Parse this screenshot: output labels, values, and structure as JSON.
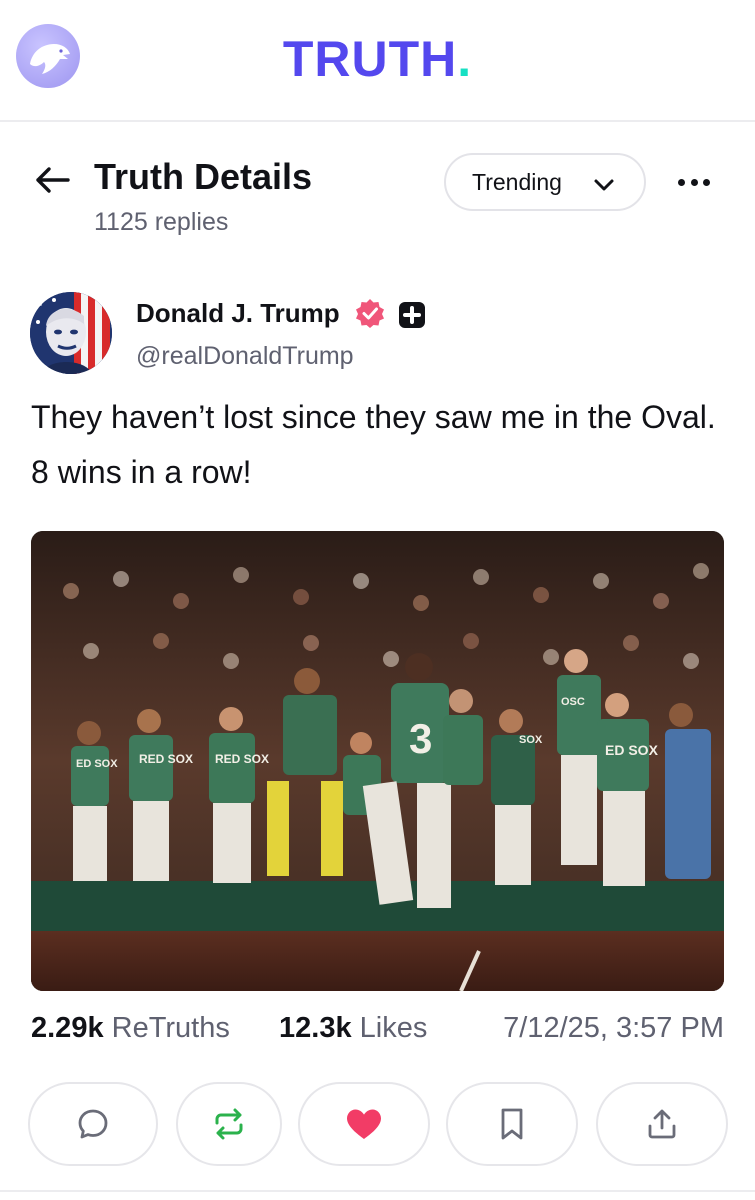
{
  "app": {
    "logo_icon": "eagle-logo-icon",
    "wordmark": "TRUTH",
    "wordmark_dot": ".",
    "brand_color": "#5448ee",
    "accent_color": "#17e0c3"
  },
  "header": {
    "back_icon": "arrow-left-icon",
    "title": "Truth Details",
    "replies": "1125 replies",
    "sort_label": "Trending",
    "sort_icon": "chevron-down-icon",
    "more_icon": "more-horizontal-icon"
  },
  "post": {
    "author_name": "Donald J. Trump",
    "author_handle": "@realDonaldTrump",
    "verified_icon": "verified-badge-icon",
    "plus_icon": "plus-badge-icon",
    "text": "They haven’t lost since they saw me in the Oval. 8 wins in a row!",
    "image_icon": "baseball-team-celebration-photo",
    "player_number": "3",
    "jersey_labels": [
      "RED SOX",
      "RED SOX",
      "ED SOX",
      "SOX",
      "ED SOX",
      "OSC"
    ],
    "retruths_count": "2.29k",
    "retruths_label": "ReTruths",
    "likes_count": "12.3k",
    "likes_label": "Likes",
    "timestamp": "7/12/25, 3:57 PM"
  },
  "actions": [
    {
      "name": "reply",
      "icon": "comment-icon"
    },
    {
      "name": "retruth",
      "icon": "retruth-icon",
      "color": "#2bb24c"
    },
    {
      "name": "like",
      "icon": "heart-icon",
      "color": "#f23c66"
    },
    {
      "name": "bookmark",
      "icon": "bookmark-icon"
    },
    {
      "name": "share",
      "icon": "share-icon"
    }
  ]
}
